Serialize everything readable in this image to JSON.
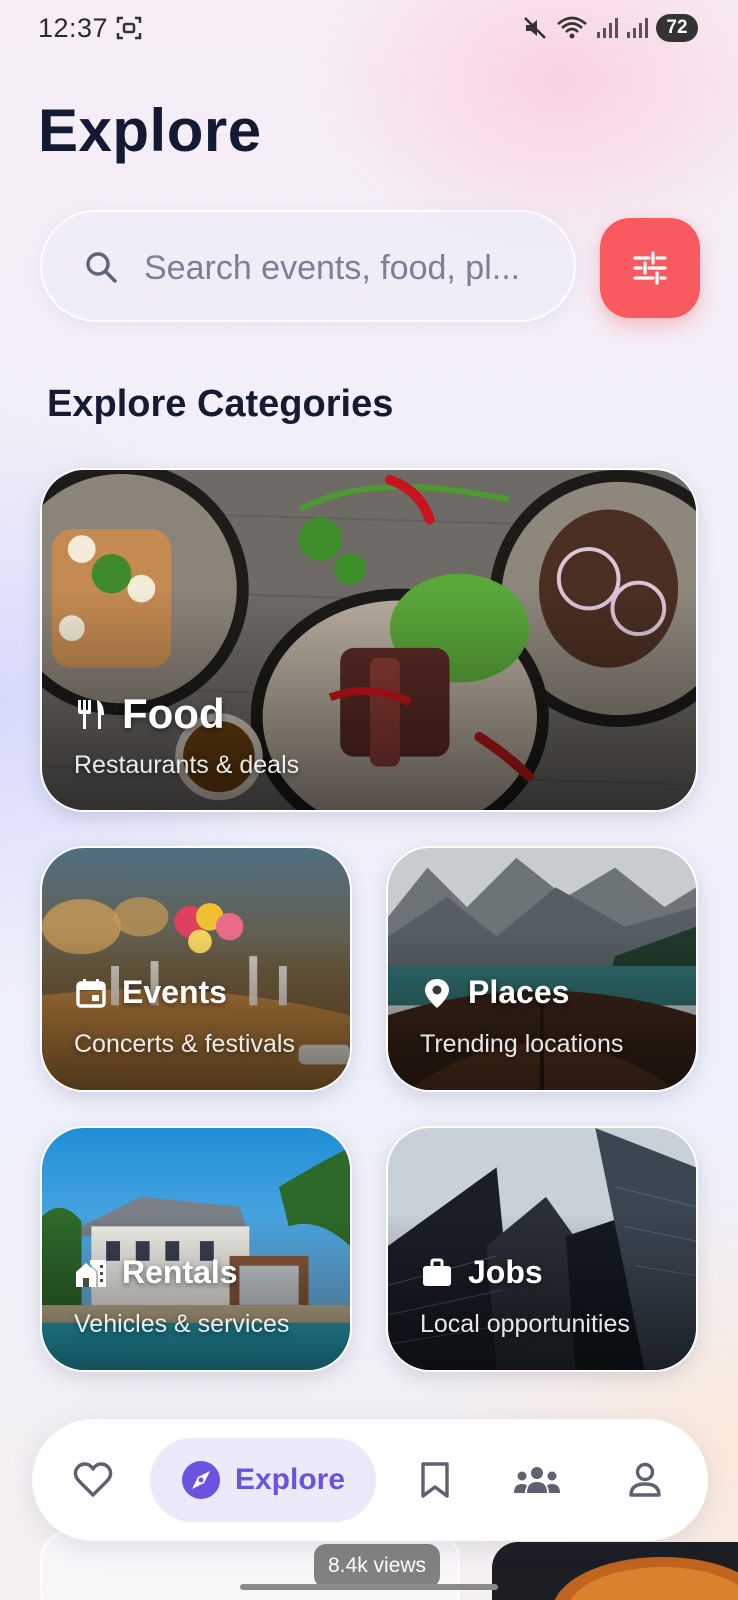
{
  "status_bar": {
    "time": "12:37",
    "battery": "72",
    "icons": [
      "screenshot-icon",
      "mute-icon",
      "wifi-icon",
      "signal-icon",
      "signal-icon"
    ]
  },
  "header": {
    "title": "Explore"
  },
  "search": {
    "placeholder": "Search events, food, pl..."
  },
  "filter": {
    "icon": "sliders-icon",
    "color": "#f95a5f"
  },
  "categories_section": {
    "title": "Explore Categories",
    "cards": [
      {
        "title": "Food",
        "subtitle": "Restaurants & deals",
        "icon": "utensils-icon"
      },
      {
        "title": "Events",
        "subtitle": "Concerts & festivals",
        "icon": "calendar-icon"
      },
      {
        "title": "Places",
        "subtitle": "Trending locations",
        "icon": "location-pin-icon"
      },
      {
        "title": "Rentals",
        "subtitle": "Vehicles & services",
        "icon": "home-rental-icon"
      },
      {
        "title": "Jobs",
        "subtitle": "Local opportunities",
        "icon": "briefcase-icon"
      }
    ]
  },
  "bottom_nav": {
    "items": [
      {
        "name": "favorites",
        "icon": "heart-icon"
      },
      {
        "name": "explore",
        "label": "Explore",
        "icon": "compass-icon",
        "active": true
      },
      {
        "name": "saved",
        "icon": "bookmark-icon"
      },
      {
        "name": "groups",
        "icon": "people-icon"
      },
      {
        "name": "profile",
        "icon": "person-icon"
      }
    ],
    "accent": "#6b52e0"
  },
  "overlay": {
    "views": "8.4k views"
  }
}
